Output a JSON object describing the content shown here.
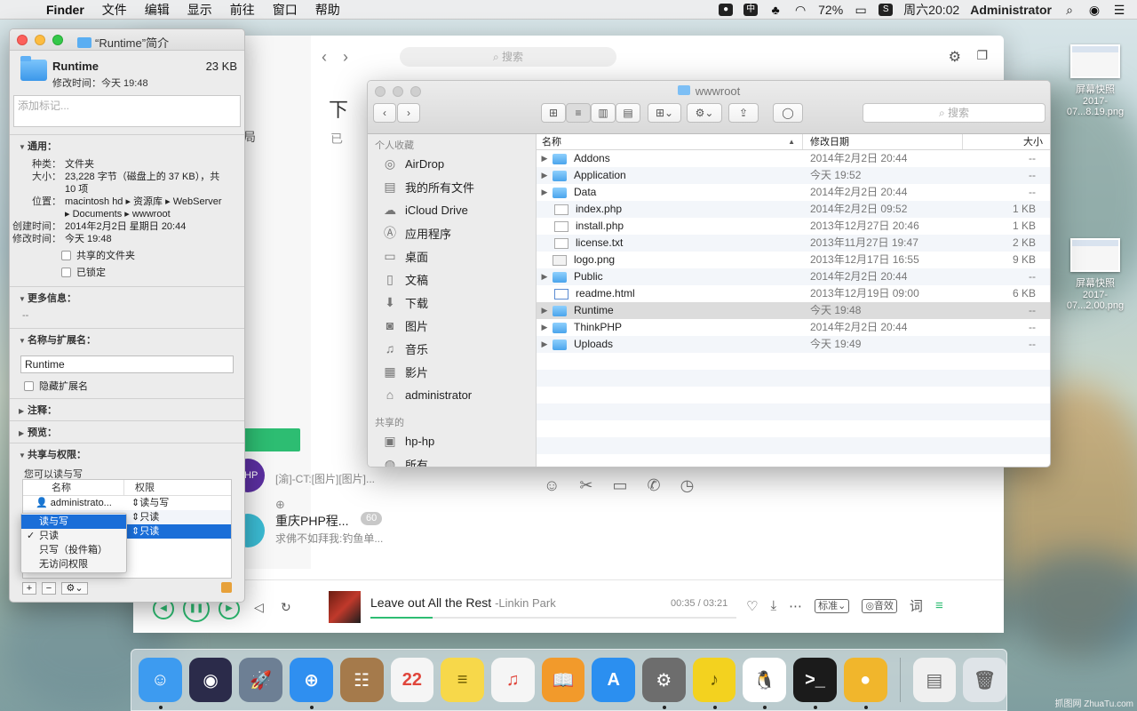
{
  "menubar": {
    "app": "Finder",
    "items": [
      "文件",
      "编辑",
      "显示",
      "前往",
      "窗口",
      "帮助"
    ],
    "battery": "72%",
    "input_method": "中",
    "datetime": "周六20:02",
    "user": "Administrator"
  },
  "info": {
    "title": "“Runtime”简介",
    "name": "Runtime",
    "size": "23 KB",
    "modified_line": "修改时间：今天 19:48",
    "tags_placeholder": "添加标记...",
    "general_title": "通用：",
    "general": [
      {
        "k": "种类：",
        "v": "文件夹"
      },
      {
        "k": "大小：",
        "v": "23,228 字节（磁盘上的 37 KB），共 10 项"
      },
      {
        "k": "位置：",
        "v": "macintosh hd ▸ 资源库 ▸ WebServer ▸ Documents ▸ wwwroot"
      },
      {
        "k": "创建时间：",
        "v": "2014年2月2日 星期日 20:44"
      },
      {
        "k": "修改时间：",
        "v": "今天 19:48"
      }
    ],
    "shared_folder": "共享的文件夹",
    "locked": "已锁定",
    "more_info_title": "更多信息：",
    "more_info_value": "--",
    "name_ext_title": "名称与扩展名：",
    "name_value": "Runtime",
    "hide_ext": "隐藏扩展名",
    "comments_title": "注释：",
    "preview_title": "预览：",
    "sharing_title": "共享与权限：",
    "sharing_desc": "您可以读与写",
    "perm_headers": [
      "名称",
      "权限"
    ],
    "perm_rows": [
      {
        "name": "administrato...",
        "perm": "读与写"
      },
      {
        "name": "",
        "perm": "只读"
      },
      {
        "name": "",
        "perm": "只读"
      }
    ],
    "dropdown": [
      "读与写",
      "只读",
      "只写（投件箱）",
      "无访问权限"
    ]
  },
  "finder": {
    "title": "wwwroot",
    "search_placeholder": "搜索",
    "sidebar_groups": {
      "favorites": "个人收藏",
      "shared": "共享的"
    },
    "favorites": [
      {
        "label": "AirDrop",
        "icon": "airdrop-icon"
      },
      {
        "label": "我的所有文件",
        "icon": "all-files-icon"
      },
      {
        "label": "iCloud Drive",
        "icon": "cloud-icon"
      },
      {
        "label": "应用程序",
        "icon": "apps-icon"
      },
      {
        "label": "桌面",
        "icon": "desktop-icon"
      },
      {
        "label": "文稿",
        "icon": "documents-icon"
      },
      {
        "label": "下载",
        "icon": "download-icon"
      },
      {
        "label": "图片",
        "icon": "camera-icon"
      },
      {
        "label": "音乐",
        "icon": "music-icon"
      },
      {
        "label": "影片",
        "icon": "film-icon"
      },
      {
        "label": "administrator",
        "icon": "home-icon"
      }
    ],
    "shared": [
      {
        "label": "hp-hp",
        "icon": "computer-icon"
      },
      {
        "label": "所有...",
        "icon": "network-icon"
      }
    ],
    "columns": [
      "名称",
      "修改日期",
      "大小"
    ],
    "rows": [
      {
        "name": "Addons",
        "date": "2014年2月2日 20:44",
        "size": "--",
        "kind": "folder",
        "expand": "▶"
      },
      {
        "name": "Application",
        "date": "今天 19:52",
        "size": "--",
        "kind": "folder",
        "expand": "▶"
      },
      {
        "name": "Data",
        "date": "2014年2月2日 20:44",
        "size": "--",
        "kind": "folder",
        "expand": "▶"
      },
      {
        "name": "index.php",
        "date": "2014年2月2日 09:52",
        "size": "1 KB",
        "kind": "file",
        "expand": ""
      },
      {
        "name": "install.php",
        "date": "2013年12月27日 20:46",
        "size": "1 KB",
        "kind": "file",
        "expand": ""
      },
      {
        "name": "license.txt",
        "date": "2013年11月27日 19:47",
        "size": "2 KB",
        "kind": "file",
        "expand": ""
      },
      {
        "name": "logo.png",
        "date": "2013年12月17日 16:55",
        "size": "9 KB",
        "kind": "png",
        "expand": ""
      },
      {
        "name": "Public",
        "date": "2014年2月2日 20:44",
        "size": "--",
        "kind": "folder",
        "expand": "▶"
      },
      {
        "name": "readme.html",
        "date": "2013年12月19日 09:00",
        "size": "6 KB",
        "kind": "html",
        "expand": ""
      },
      {
        "name": "Runtime",
        "date": "今天 19:48",
        "size": "--",
        "kind": "folder",
        "expand": "▶",
        "selected": true
      },
      {
        "name": "ThinkPHP",
        "date": "2014年2月2日 20:44",
        "size": "--",
        "kind": "folder",
        "expand": "▶"
      },
      {
        "name": "Uploads",
        "date": "今天 19:49",
        "size": "--",
        "kind": "folder",
        "expand": "▶"
      }
    ]
  },
  "music": {
    "search_placeholder": "搜索",
    "big_text": "下",
    "sub_text": "已",
    "left_text": "局",
    "chats": [
      {
        "name": "",
        "msg": "[渝]-CT:[图片][图片]...",
        "badge": "",
        "avatar": "#5b2fa0",
        "avatar_text": "PHP"
      },
      {
        "name": "重庆PHP程...",
        "msg": "求佛不如拜我:钓鱼单...",
        "badge": "60",
        "avatar": "#3bbbd3",
        "avatar_text": ""
      }
    ],
    "song": "Leave out All the Rest",
    "artist": "-Linkin Park",
    "time": "00:35 / 03:21",
    "progress": 0.17,
    "quality": "标准",
    "effect": "音效",
    "lyrics": "词"
  },
  "desktop_files": [
    {
      "label1": "屏幕快照",
      "label2": "2017-07...8.19.png"
    },
    {
      "label1": "屏幕快照",
      "label2": "2017-07...2.00.png"
    }
  ],
  "dock": [
    {
      "name": "finder-icon",
      "bg": "#3d9bf0",
      "txt": "☺",
      "dot": true
    },
    {
      "name": "siri-icon",
      "bg": "#2b2b4a",
      "txt": "◉",
      "dot": false
    },
    {
      "name": "launchpad-icon",
      "bg": "#6d7f94",
      "txt": "🚀",
      "dot": false
    },
    {
      "name": "safari-icon",
      "bg": "#2f8ff0",
      "txt": "⊕",
      "dot": true
    },
    {
      "name": "contacts-icon",
      "bg": "#a57a4b",
      "txt": "☷",
      "dot": false
    },
    {
      "name": "calendar-icon",
      "bg": "#f5f5f5",
      "txt": "22",
      "dot": false
    },
    {
      "name": "notes-icon",
      "bg": "#f7d84a",
      "txt": "≡",
      "dot": false
    },
    {
      "name": "itunes-icon",
      "bg": "#f5f5f5",
      "txt": "♫",
      "dot": false
    },
    {
      "name": "ibooks-icon",
      "bg": "#f29a2b",
      "txt": "📖",
      "dot": false
    },
    {
      "name": "appstore-icon",
      "bg": "#2b8ff0",
      "txt": "A",
      "dot": false
    },
    {
      "name": "system-preferences-icon",
      "bg": "#6d6d6d",
      "txt": "⚙",
      "dot": true
    },
    {
      "name": "qq-music-icon",
      "bg": "#f3d21f",
      "txt": "♪",
      "dot": true
    },
    {
      "name": "qq-icon",
      "bg": "#ffffff",
      "txt": "🐧",
      "dot": true
    },
    {
      "name": "terminal-icon",
      "bg": "#1b1b1b",
      "txt": ">_",
      "dot": true
    },
    {
      "name": "pear-icon",
      "bg": "#f1b62c",
      "txt": "●",
      "dot": true
    }
  ],
  "dock_right": [
    {
      "name": "preview-icon",
      "bg": "#f0f0f0"
    },
    {
      "name": "trash-icon",
      "bg": "#dfe4e8"
    }
  ],
  "watermark": "抓图网 ZhuaTu.com"
}
